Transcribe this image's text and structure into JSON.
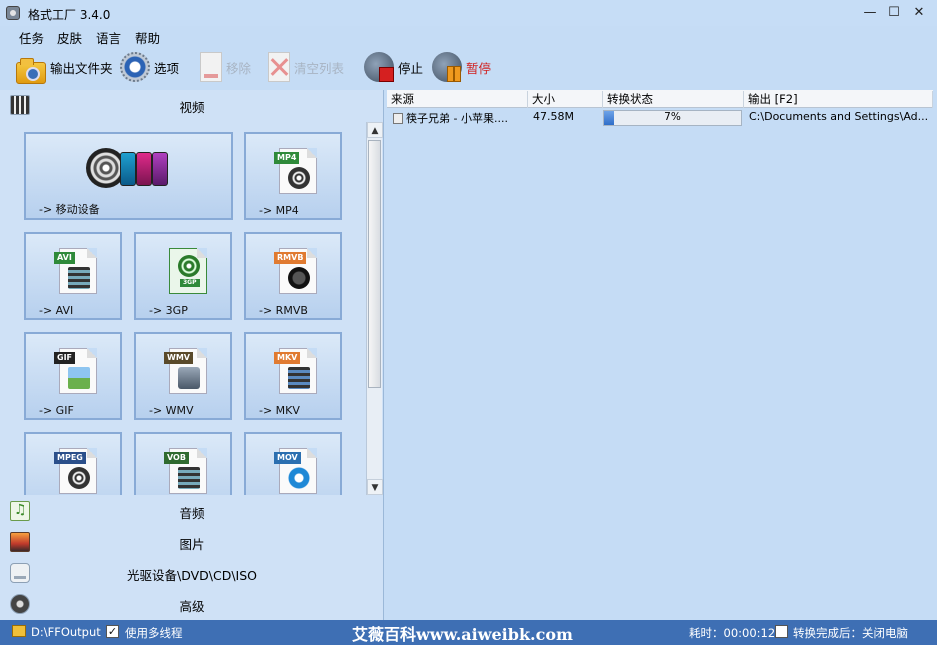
{
  "window": {
    "title": "格式工厂 3.4.0",
    "minimize": "—",
    "maximize": "☐",
    "close": "✕"
  },
  "menu": [
    "任务",
    "皮肤",
    "语言",
    "帮助"
  ],
  "toolbar": {
    "output_folder": "输出文件夹",
    "options": "选项",
    "remove": "移除",
    "clear_list": "清空列表",
    "stop": "停止",
    "pause": "暂停"
  },
  "categories": {
    "video": "视频",
    "audio": "音频",
    "image": "图片",
    "optical": "光驱设备\\DVD\\CD\\ISO",
    "advanced": "高级"
  },
  "tiles": [
    {
      "label": "-> 移动设备"
    },
    {
      "label": "-> MP4",
      "tag": "MP4",
      "tag_color": "#2f8a3a"
    },
    {
      "label": "-> AVI",
      "tag": "AVI",
      "tag_color": "#2f8a3a"
    },
    {
      "label": "-> 3GP",
      "tag": "3GP",
      "tag_color": "#2f8a3a"
    },
    {
      "label": "-> RMVB",
      "tag": "RMVB",
      "tag_color": "#e07a30"
    },
    {
      "label": "-> GIF",
      "tag": "GIF",
      "tag_color": "#222222"
    },
    {
      "label": "-> WMV",
      "tag": "WMV",
      "tag_color": "#5a4a2a"
    },
    {
      "label": "-> MKV",
      "tag": "MKV",
      "tag_color": "#e07a30"
    },
    {
      "label": "",
      "tag": "MPEG",
      "tag_color": "#2b4f8a"
    },
    {
      "label": "",
      "tag": "VOB",
      "tag_color": "#2f6a2f"
    },
    {
      "label": "",
      "tag": "MOV",
      "tag_color": "#2b6fb0"
    }
  ],
  "task_list": {
    "columns": [
      "来源",
      "大小",
      "转换状态",
      "输出 [F2]"
    ],
    "rows": [
      {
        "source": "筷子兄弟 - 小苹果....",
        "size": "47.58M",
        "progress": 0.07,
        "progress_text": "7%",
        "output": "C:\\Documents and Settings\\Ad..."
      }
    ]
  },
  "status": {
    "folder": "D:\\FFOutput",
    "multithread_label": "使用多线程",
    "multithread_checked": true,
    "watermark": "艾薇百科www.aiweibk.com",
    "elapsed": "耗时：00:00:12",
    "after_label": "转换完成后：关闭电脑",
    "after_checked": false
  }
}
